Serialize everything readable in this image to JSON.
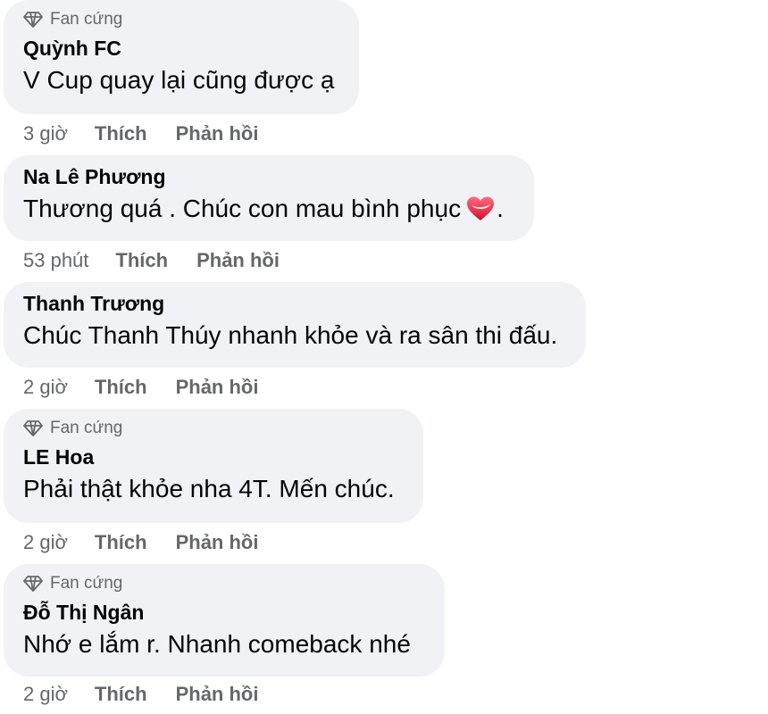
{
  "comments": [
    {
      "badge": "Fan cứng",
      "author": "Quỳnh FC",
      "text": "V Cup quay lại cũng được ạ",
      "time": "3 giờ",
      "like": "Thích",
      "reply": "Phản hồi"
    },
    {
      "author": "Na Lê Phương",
      "text": "Thương quá . Chúc con mau bình phục",
      "text_suffix": ".",
      "emoji": "heart-icon",
      "time": "53 phút",
      "like": "Thích",
      "reply": "Phản hồi"
    },
    {
      "author": "Thanh Trương",
      "text": "Chúc Thanh Thúy nhanh khỏe và ra sân thi đấu.",
      "time": "2 giờ",
      "like": "Thích",
      "reply": "Phản hồi"
    },
    {
      "badge": "Fan cứng",
      "author": "LE Hoa",
      "text": "Phải thật khỏe nha 4T. Mến chúc.",
      "time": "2 giờ",
      "like": "Thích",
      "reply": "Phản hồi"
    },
    {
      "badge": "Fan cứng",
      "author": "Đỗ Thị Ngân",
      "text": "Nhớ e lắm r. Nhanh comeback nhé",
      "time": "2 giờ",
      "like": "Thích",
      "reply": "Phản hồi"
    }
  ],
  "colors": {
    "bubble": "#f0f2f5",
    "secondary_text": "#65676b",
    "primary_text": "#050505",
    "heart": "#e41e3f"
  }
}
